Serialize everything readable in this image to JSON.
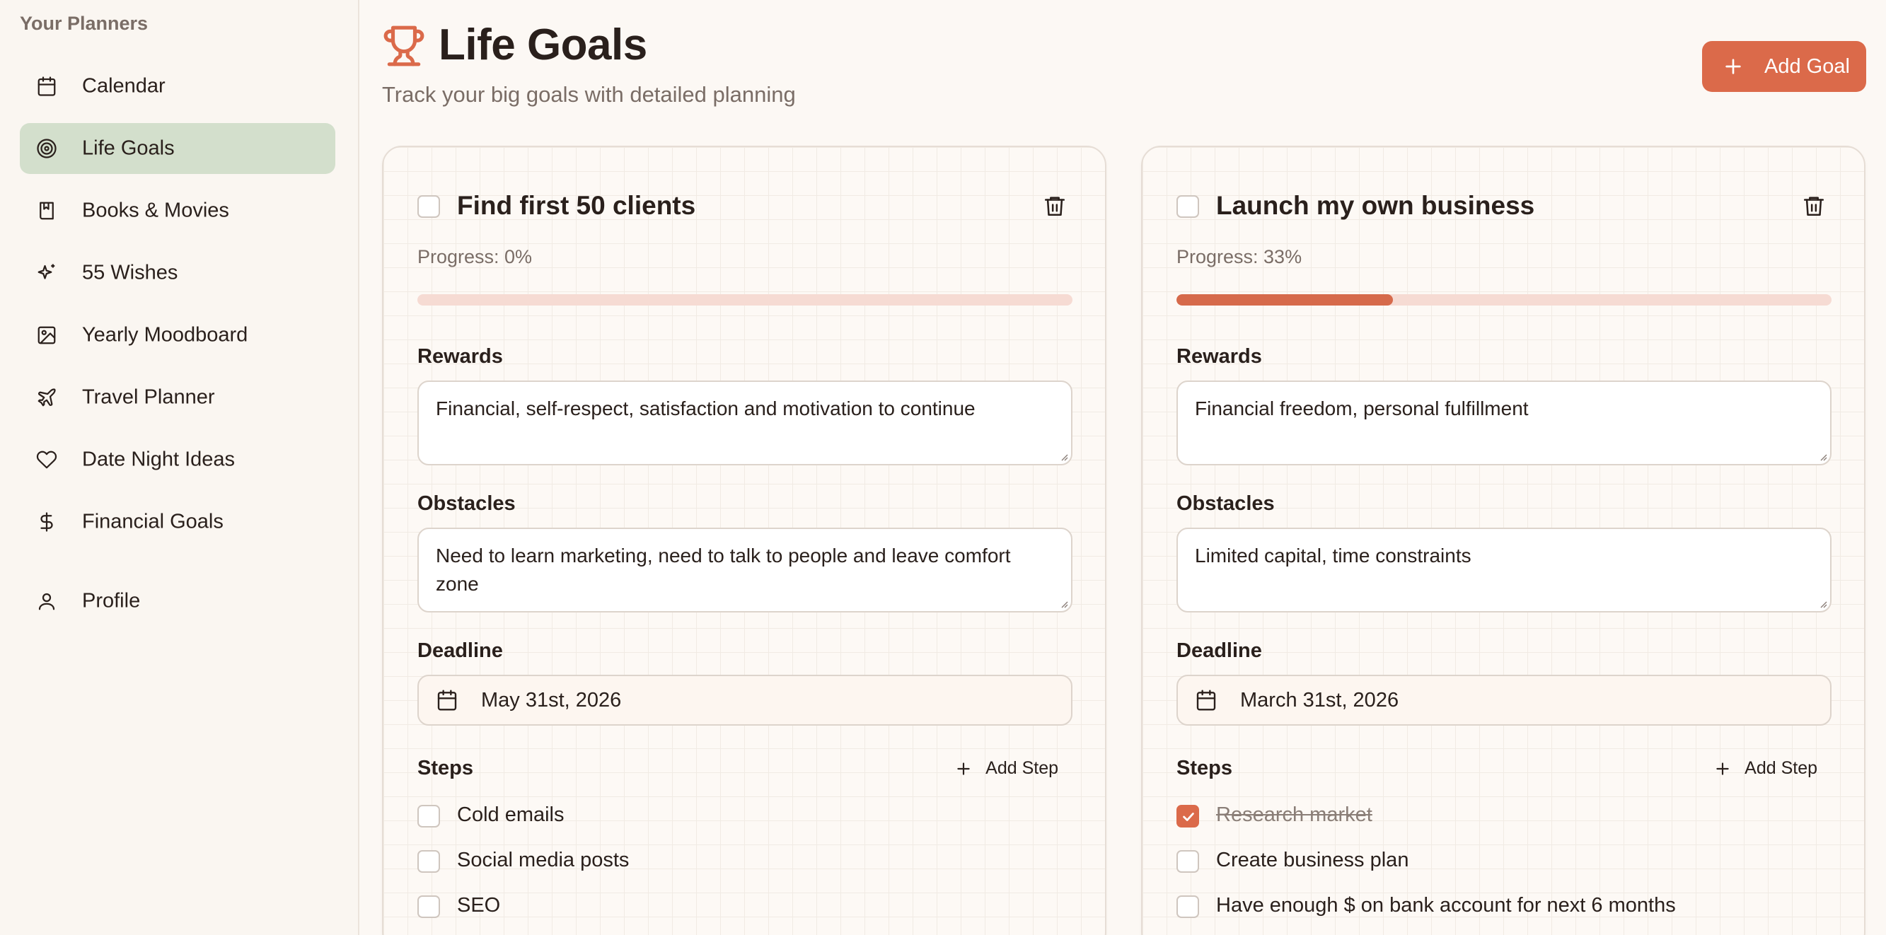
{
  "sidebar": {
    "title": "Your Planners",
    "items": [
      {
        "label": "Calendar",
        "icon": "calendar-icon",
        "active": false
      },
      {
        "label": "Life Goals",
        "icon": "target-icon",
        "active": true
      },
      {
        "label": "Books & Movies",
        "icon": "book-icon",
        "active": false
      },
      {
        "label": "55 Wishes",
        "icon": "sparkles-icon",
        "active": false
      },
      {
        "label": "Yearly Moodboard",
        "icon": "image-icon",
        "active": false
      },
      {
        "label": "Travel Planner",
        "icon": "plane-icon",
        "active": false
      },
      {
        "label": "Date Night Ideas",
        "icon": "heart-icon",
        "active": false
      },
      {
        "label": "Financial Goals",
        "icon": "dollar-icon",
        "active": false
      }
    ],
    "profile": {
      "label": "Profile",
      "icon": "user-icon"
    }
  },
  "header": {
    "title": "Life Goals",
    "icon": "trophy-icon",
    "subtitle": "Track your big goals with detailed planning",
    "add_goal_label": "Add Goal"
  },
  "colors": {
    "accent": "#db6a4a",
    "active_nav": "#d3dfcc",
    "progress_track": "#f6dbd3"
  },
  "goals": [
    {
      "title": "Find first 50 clients",
      "completed": false,
      "progress_label": "Progress: 0%",
      "progress": 0,
      "rewards_label": "Rewards",
      "rewards": "Financial, self-respect, satisfaction and motivation to continue",
      "obstacles_label": "Obstacles",
      "obstacles": "Need to learn marketing, need to talk to people and leave comfort zone",
      "deadline_label": "Deadline",
      "deadline": "May 31st, 2026",
      "steps_label": "Steps",
      "add_step_label": "Add Step",
      "steps": [
        {
          "text": "Cold emails",
          "done": false
        },
        {
          "text": "Social media posts",
          "done": false
        },
        {
          "text": "SEO",
          "done": false
        }
      ]
    },
    {
      "title": "Launch my own business",
      "completed": false,
      "progress_label": "Progress: 33%",
      "progress": 33,
      "rewards_label": "Rewards",
      "rewards": "Financial freedom, personal fulfillment",
      "obstacles_label": "Obstacles",
      "obstacles": "Limited capital, time constraints",
      "deadline_label": "Deadline",
      "deadline": "March 31st, 2026",
      "steps_label": "Steps",
      "add_step_label": "Add Step",
      "steps": [
        {
          "text": "Research market",
          "done": true
        },
        {
          "text": "Create business plan",
          "done": false
        },
        {
          "text": "Have enough $ on bank account for next 6 months",
          "done": false
        }
      ]
    }
  ]
}
